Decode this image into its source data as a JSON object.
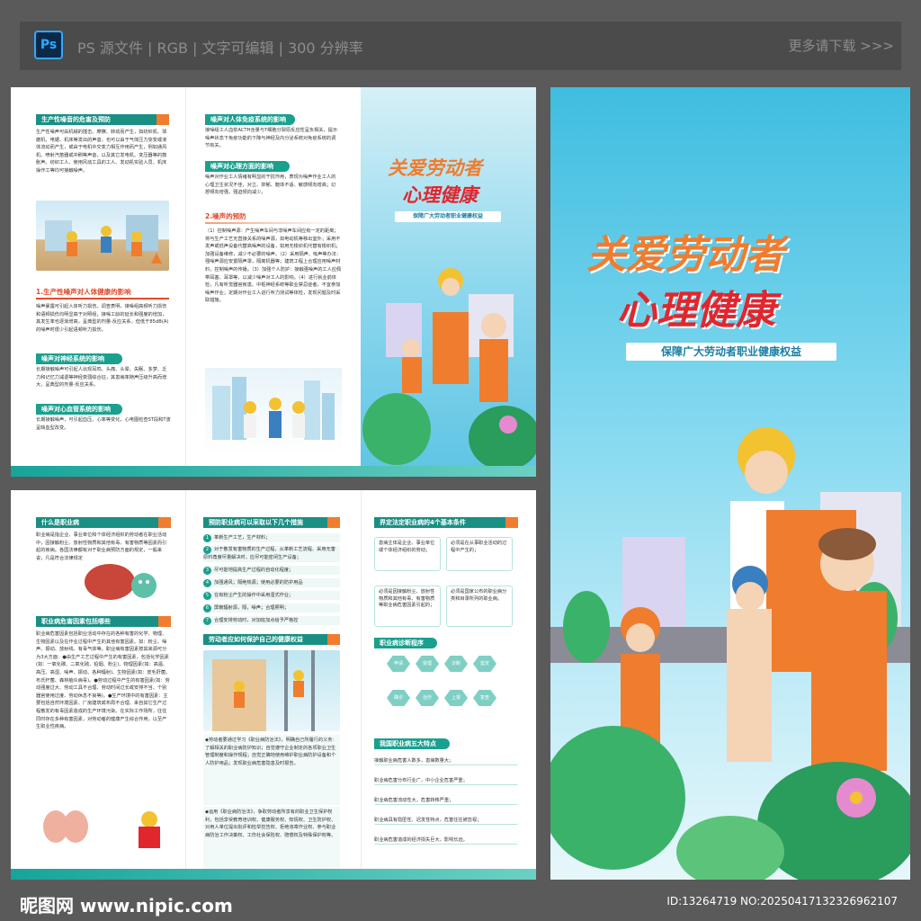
{
  "header": {
    "app_badge": "Ps",
    "specs": "PS 源文件 | RGB | 文字可编辑 | 300 分辨率",
    "more_link": "更多请下载 >>>"
  },
  "panel1": {
    "sec1_title": "生产性噪音的危害及预防",
    "sec1_text": "生产性噪声可由机械的撞击、摩擦、转动而产生，如纺织机、球磨机、电锯、机床等发出的声音，也可以由于气体压力突变或液体流动而产生，或由于电机中交变力相互作用而产生，例如通风机、喷射汽笛器或冲刷等声音，以及其它发电机、变压器等的鼓胀声。纺织工人、使用风动工具的工人、发动机实验人员、机床操作工等均可接触噪声。",
    "sec2_red": "1.生产性噪声对人体健康的影响",
    "sec2_text": "噪声暴露可引起人体听力损伤。调查表明，接噪组高频听力损伤和语频损伤均明显高于对照组，接噪工龄的延长和强度的增加，其发生率也逐渐增高，呈典型的剂量-反应关系，但低于85dB(A)的噪声时很少引起语频听力损伤。",
    "sec3_title": "噪声对神经系统的影响",
    "sec3_text": "长期接触噪声可引起人出现耳鸣、头痛、头晕、失眠、多梦、乏力和记忆力减退等神经衰弱综合征，其患病率随声压级升高而增大，呈典型的剂量-反应关系。",
    "sec4_title": "噪声对心血管系统的影响",
    "sec4_text": "长期接触噪声，可引起血压、心率等变化，心电图检查ST段和T波呈缺血型改变。",
    "col2_sec1_title": "噪声对人体免疫系统的影响",
    "col2_sec1_text": "接噪组工人血浆ACTH含量与T细胞分裂原反应性呈负相关，提示噪声状态下免疫功能的下降与神经及内分泌系统对免疫系统的调节有关。",
    "col2_sec2_title": "噪声对心理方面的影响",
    "col2_sec2_text": "噪声对作业工人情绪有明显的干扰作用，表现为噪声作业工人的心理卫生状况不佳，对立、抑郁、躯体不适、敏感倾向增高；幻想倾向增强，强迫倾向减少。",
    "col2_red": "2.噪声的预防",
    "col2_prevent": "（1）控制噪声源：产生噪声车间与非噪声车间应有一定的距离；将与生产工艺无直接关系的噪声源，如电动机等移出室外；采用不发声或低声设备代替高噪声的设备，如用无梭织机代替有梭织机；加强设备维修，减少不必要的噪声。（2）采用隔声、吸声等办法：强噪声源应安置隔声罩，隔离机器等；建筑工程上合理应用噪声材料，控制噪声的传播。（3）加强个人防护：接触强噪声的工人应佩带耳塞、耳罩等，以减少噪声对工人的影响。（4）进行就业前体检，凡有听觉器官疾患、中枢神经系统等职业禁忌症者，不宜参加噪声作业；定期对作业工人进行听力测试等体检，发现问题及时采取措施。"
  },
  "panel1_cover": {
    "title_line1": "关爱劳动者",
    "title_line2": "心理健康",
    "banner": "保障广大劳动者职业健康权益"
  },
  "panel2": {
    "sec1_title": "什么是职业病",
    "sec1_text": "职业病是指企业、事业单位和个体经济组织的劳动者在职业活动中，因接触粉尘、放射性物质和其他有毒、有害物质等因素而引起的疾病。各国法律都有对于职业病预防方面的规定，一般来说，凡是符合法律规定的疾病才能称为职业病。",
    "sec2_title": "职业病危害因素包括哪些",
    "sec2_text": "职业病危害因素包括职业活动中存在的各种有害的化学、物理、生物因素以及在作业过程中产生的其他有害因素。如：粉尘、噪声、振动、放射线、有毒气体等。职业病有害因素按其来源可分为3大方面：●由生产工艺过程中产生的有害因素，包括化学因素(如：一氧化碳、二氧化硫、铅烟、粉尘)、物理因素(如：高温、高压、高湿、噪声、振动、各种辐射)、生物因素(如：皮毛肝菌、布氏杆菌、森林脑炎病毒)。●劳动过程中产生的有害因素(如：劳动强度过大、劳动工具不合理、劳动时间过长或安排不当、个别器官使用过度、劳动休息不良等)。●生产环境中的有害因素：主要包括自然环境因素、厂房建筑或布局不合理、来自其它生产过程散发的有毒因素造成的生产环境污染。在实际工作场所，往往同时存在多种有害因素，对劳动者的健康产生综合作用，以至产生职业性疾病。",
    "col2_sec1_title": "预防职业病可以采取以下几个措施",
    "measures": [
      "革新生产工艺，生产材料；",
      "对于散发有害物质的生产过程，从革新工艺流程、采用无害原料角度尽量解决时，应尽可能密闭生产设备；",
      "尽可能地提高生产过程的自动化程度；",
      "加强通风；隔绝热源；使用必要的防护用品",
      "在有粉尘产生的操作中采用湿式作业；",
      "屏蔽辐射源，隔，噪声；合理照明；",
      "合理安排劳动时，对加班加点给予严格控"
    ],
    "col2_sec2_title": "劳动者应如何保护自己的健康权益",
    "col2_sec2_text": "◆劳动者要通过学习《职业病防治法》，明确自己所履行的义务：了解相关的职业病防护知识；自觉遵守企业制定的各项职业卫生管理制度和操作规程；自觉正确地使用维护职业病防护设备和个人防护用品；发现职业病危害隐患及时报告。",
    "col2_sec2_text2": "◆运用《职业病防治法》，争取劳动者所享有的职业卫生保护权利，包括享受教育培训权、健康服务权、知情权、卫生防护权、对用人单位提出批评和检举控告权、拒绝违章作业权、参与职业病防治工作决策权、工伤社会保险权、赔偿权及特殊保护权等。",
    "col3_sec1_title": "界定法定职业病的4个基本条件",
    "conditions": [
      "患病主体是企业、事业单位或个体经济组织的劳动；",
      "必须是在从事职业活动的过程中产生的；",
      "必须是因接触粉尘、放射性物质和其他有毒、有害物质等职业病危害因素引起的；",
      "必须是国家公布的职业病分类和目录所列的职业病。"
    ],
    "col3_sec2_title": "职业病诊断程序",
    "diag_steps": [
      "申请",
      "受理",
      "诊断",
      "鉴定",
      "确诊",
      "治疗",
      "上报",
      "复查"
    ],
    "col3_sec3_title": "我国职业病五大特点",
    "features": [
      "接触职业病危害人数多，患病数量大；",
      "职业病危害分布行业广，中小企业危害严重；",
      "职业病危害流动性大，危害转移严重；",
      "职业病具有隐匿性、迟发性特点，危害往往被忽视；",
      "职业病危害造成的经济损失巨大，影响长远。"
    ]
  },
  "cover": {
    "title_line1": "关爱劳动者",
    "title_line2": "心理健康",
    "banner": "保障广大劳动者职业健康权益"
  },
  "footer": {
    "site": "昵图网 www.nipic.com",
    "id": "ID:13264719 NO:20250417132326962107"
  },
  "colors": {
    "teal": "#1aa08e",
    "orange": "#f07c2e",
    "red": "#e14b2a",
    "sky": "#3fbde0"
  }
}
